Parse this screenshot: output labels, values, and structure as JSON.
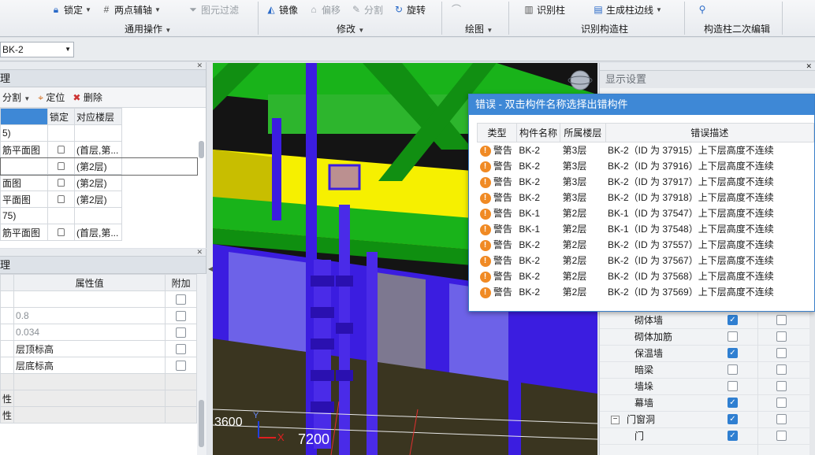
{
  "ribbon": {
    "btn_lock": "锁定",
    "btn_axis": "两点辅轴",
    "btn_filter": "图元过滤",
    "btn_mirror": "镜像",
    "btn_offset": "偏移",
    "btn_split": "分割",
    "btn_rotate": "旋转",
    "btn_recognize": "识别柱",
    "btn_edge": "生成柱边线",
    "group_general": "通用操作",
    "group_modify": "修改",
    "group_draw": "绘图",
    "group_recognize": "识别构造柱",
    "group_edit": "构造柱二次编辑"
  },
  "toolbar": {
    "component_select": "BK-2"
  },
  "layer_panel": {
    "title": "理",
    "split_label": "分割",
    "locate_label": "定位",
    "delete_label": "删除",
    "col_lock": "锁定",
    "col_floor": "对应楼层",
    "rows": [
      {
        "name": "5)",
        "floor": "",
        "lock": false
      },
      {
        "name": "筋平面图",
        "floor": "(首层,第...",
        "lock": true
      },
      {
        "name": "",
        "floor": "(第2层)",
        "lock": true
      },
      {
        "name": "面图",
        "floor": "(第2层)",
        "lock": true
      },
      {
        "name": "平面图",
        "floor": "(第2层)",
        "lock": true
      },
      {
        "name": "75)",
        "floor": "",
        "lock": false
      },
      {
        "name": "筋平面图",
        "floor": "(首层,第...",
        "lock": true
      }
    ]
  },
  "prop_panel": {
    "title": "理",
    "col_value": "属性值",
    "col_extra": "附加",
    "rows": [
      {
        "name": "",
        "value": "",
        "gray": false
      },
      {
        "name": "",
        "value": "0.8",
        "gray": true
      },
      {
        "name": "",
        "value": "0.034",
        "gray": true
      },
      {
        "name": "",
        "value": "层顶标高",
        "gray": false
      },
      {
        "name": "",
        "value": "层底标高",
        "gray": false
      },
      {
        "name": "",
        "value": "",
        "gray": false
      },
      {
        "name": "性",
        "value": "",
        "gray": false
      },
      {
        "name": "性",
        "value": "",
        "gray": false
      }
    ]
  },
  "viewport": {
    "dim_left": "3600",
    "dim_bottom": "7200",
    "axis_x": "X",
    "axis_y": "Y"
  },
  "dialog": {
    "title": "错误 - 双击构件名称选择出错构件",
    "col_type": "类型",
    "col_name": "构件名称",
    "col_floor": "所属楼层",
    "col_desc": "错误描述",
    "rows": [
      {
        "type": "警告",
        "name": "BK-2",
        "floor": "第3层",
        "desc": "BK-2（ID 为 37915）上下层高度不连续"
      },
      {
        "type": "警告",
        "name": "BK-2",
        "floor": "第3层",
        "desc": "BK-2（ID 为 37916）上下层高度不连续"
      },
      {
        "type": "警告",
        "name": "BK-2",
        "floor": "第3层",
        "desc": "BK-2（ID 为 37917）上下层高度不连续"
      },
      {
        "type": "警告",
        "name": "BK-2",
        "floor": "第3层",
        "desc": "BK-2（ID 为 37918）上下层高度不连续"
      },
      {
        "type": "警告",
        "name": "BK-1",
        "floor": "第2层",
        "desc": "BK-1（ID 为 37547）上下层高度不连续"
      },
      {
        "type": "警告",
        "name": "BK-1",
        "floor": "第2层",
        "desc": "BK-1（ID 为 37548）上下层高度不连续"
      },
      {
        "type": "警告",
        "name": "BK-2",
        "floor": "第2层",
        "desc": "BK-2（ID 为 37557）上下层高度不连续"
      },
      {
        "type": "警告",
        "name": "BK-2",
        "floor": "第2层",
        "desc": "BK-2（ID 为 37567）上下层高度不连续"
      },
      {
        "type": "警告",
        "name": "BK-2",
        "floor": "第2层",
        "desc": "BK-2（ID 为 37568）上下层高度不连续"
      },
      {
        "type": "警告",
        "name": "BK-2",
        "floor": "第2层",
        "desc": "BK-2（ID 为 37569）上下层高度不连续"
      }
    ]
  },
  "display_panel": {
    "title": "显示设置",
    "rows": [
      {
        "label": "砌体墙",
        "show": true,
        "name": false,
        "indent": true,
        "folder": false
      },
      {
        "label": "砌体加筋",
        "show": false,
        "name": false,
        "indent": true,
        "folder": false
      },
      {
        "label": "保温墙",
        "show": true,
        "name": false,
        "indent": true,
        "folder": false
      },
      {
        "label": "暗梁",
        "show": false,
        "name": false,
        "indent": true,
        "folder": false
      },
      {
        "label": "墙垛",
        "show": false,
        "name": false,
        "indent": true,
        "folder": false
      },
      {
        "label": "幕墙",
        "show": true,
        "name": false,
        "indent": true,
        "folder": false
      },
      {
        "label": "门窗洞",
        "show": true,
        "name": false,
        "indent": false,
        "folder": true
      },
      {
        "label": "门",
        "show": true,
        "name": false,
        "indent": true,
        "folder": false
      }
    ]
  },
  "colors": {
    "accent": "#3e88d6",
    "beam_green": "#19b31a",
    "column_blue": "#3b1de0",
    "wall_yellow": "#f6f000",
    "warn": "#f08a24"
  }
}
